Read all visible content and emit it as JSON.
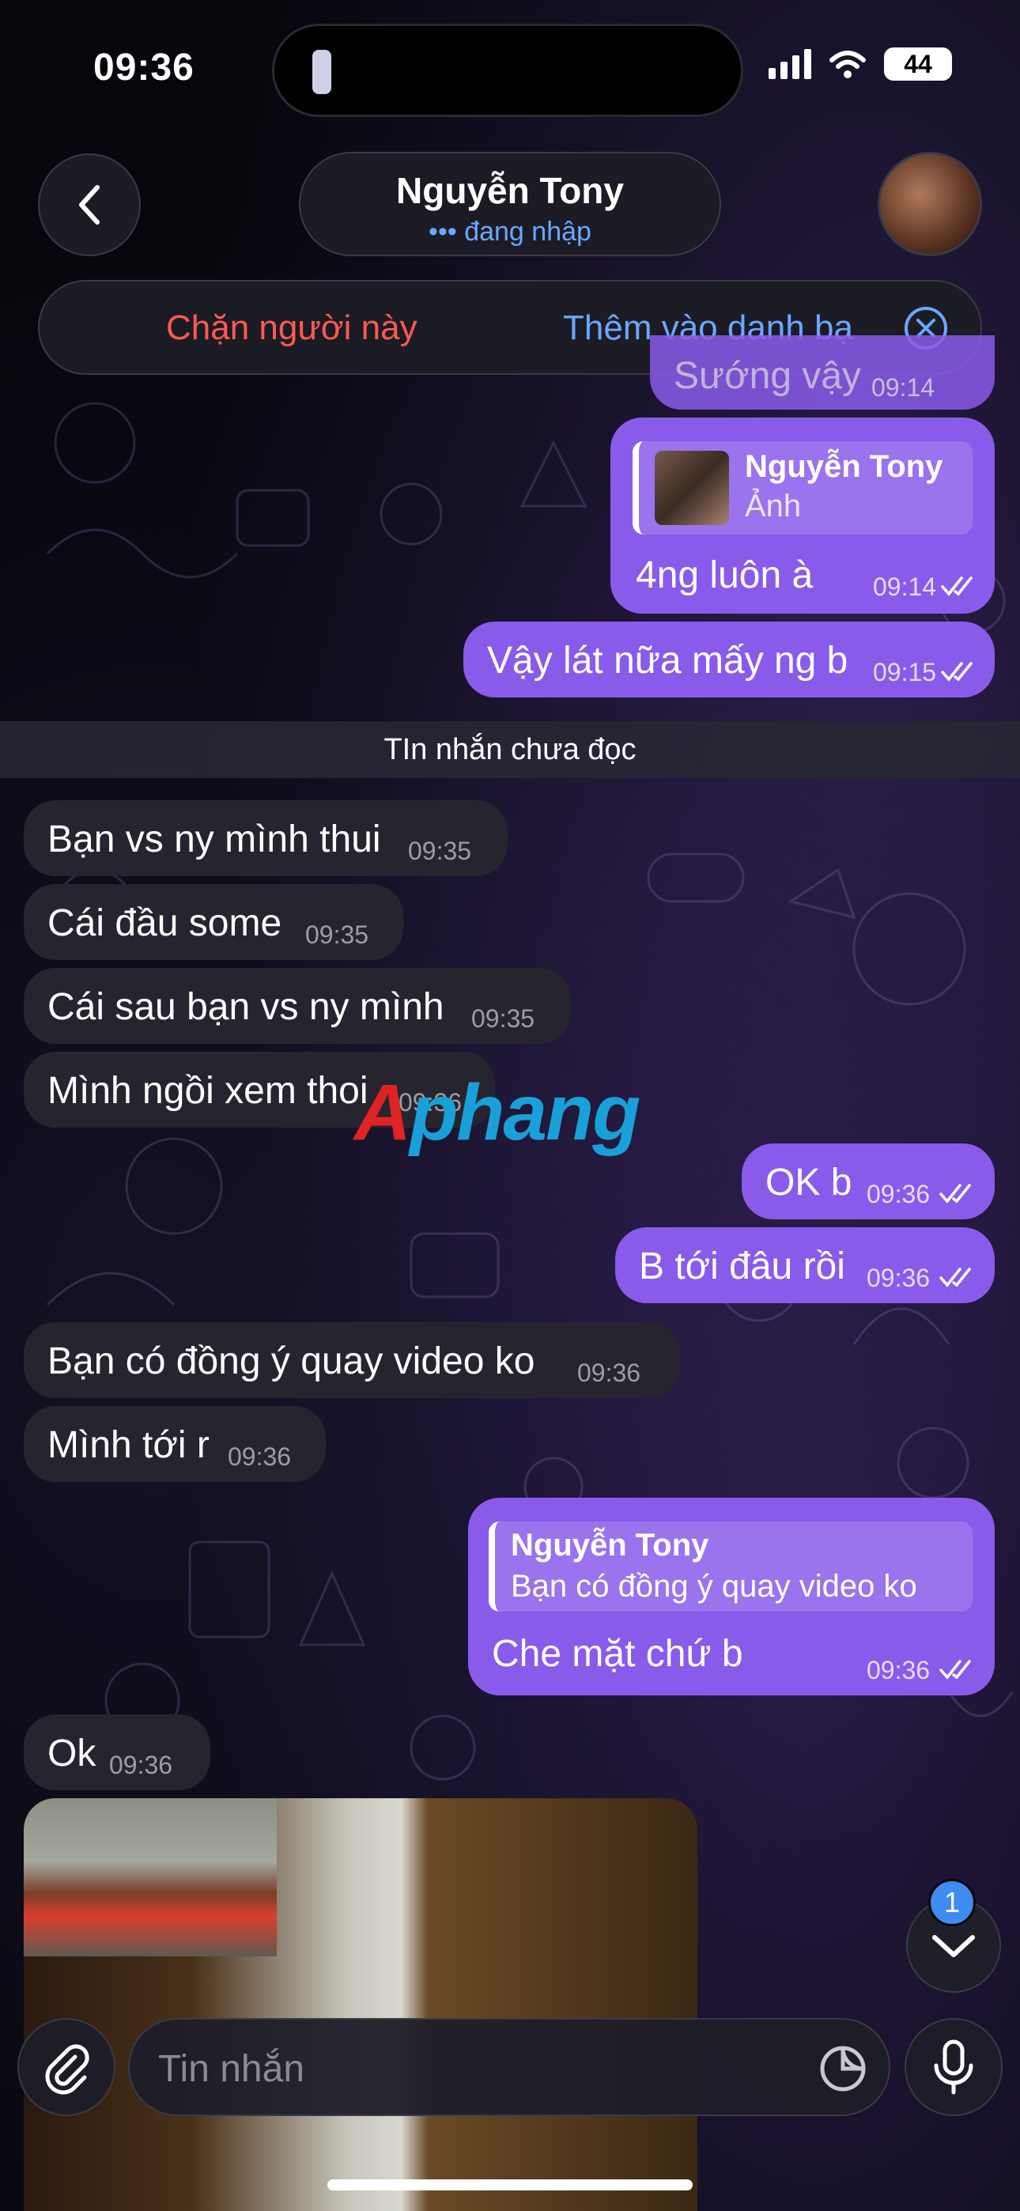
{
  "status_bar": {
    "time": "09:36",
    "battery": "44"
  },
  "header": {
    "title": "Nguyễn Tony",
    "subtitle": "••• đang nhập",
    "back_icon": "chevron-left-icon",
    "avatar_icon": "avatar"
  },
  "action_bar": {
    "block_label": "Chặn người này",
    "add_contact_label": "Thêm vào danh bạ",
    "close_icon": "close-circle-icon"
  },
  "messages_before_unread": [
    {
      "direction": "out",
      "text": "Sướng vậy",
      "time": "09:14",
      "partial": true
    },
    {
      "direction": "out",
      "reply_to": {
        "name": "Nguyễn Tony",
        "text": "Ảnh"
      },
      "text": "4ng luôn à",
      "time": "09:14"
    },
    {
      "direction": "out",
      "text": "Vậy lát nữa mấy ng b",
      "time": "09:15"
    }
  ],
  "unread_divider": "TIn nhắn chưa đọc",
  "messages": [
    {
      "direction": "in",
      "text": "Bạn vs ny mình thui",
      "time": "09:35"
    },
    {
      "direction": "in",
      "text": "Cái đầu some",
      "time": "09:35"
    },
    {
      "direction": "in",
      "text": "Cái sau bạn vs ny mình",
      "time": "09:35"
    },
    {
      "direction": "in",
      "text": "Mình ngồi xem thoi",
      "time": "09:36"
    },
    {
      "direction": "out",
      "text": "OK b",
      "time": "09:36"
    },
    {
      "direction": "out",
      "text": "B tới đâu rồi",
      "time": "09:36"
    },
    {
      "direction": "in",
      "text": "Bạn có đồng ý quay video ko",
      "time": "09:36"
    },
    {
      "direction": "in",
      "text": "Mình tới r",
      "time": "09:36"
    },
    {
      "direction": "out",
      "reply_to": {
        "name": "Nguyễn Tony",
        "text": "Bạn có đồng ý quay video ko"
      },
      "text": "Che mặt chứ b",
      "time": "09:36"
    },
    {
      "direction": "in",
      "text": "Ok",
      "time": "09:36"
    }
  ],
  "watermark": {
    "a": "A",
    "rest": "phang"
  },
  "scroll_down": {
    "badge": "1"
  },
  "composer": {
    "placeholder": "Tin nhắn"
  },
  "colors": {
    "outgoing": "#8a5bea",
    "incoming": "#26252f",
    "accent": "#6aa8ff",
    "danger": "#ff5a4f"
  }
}
